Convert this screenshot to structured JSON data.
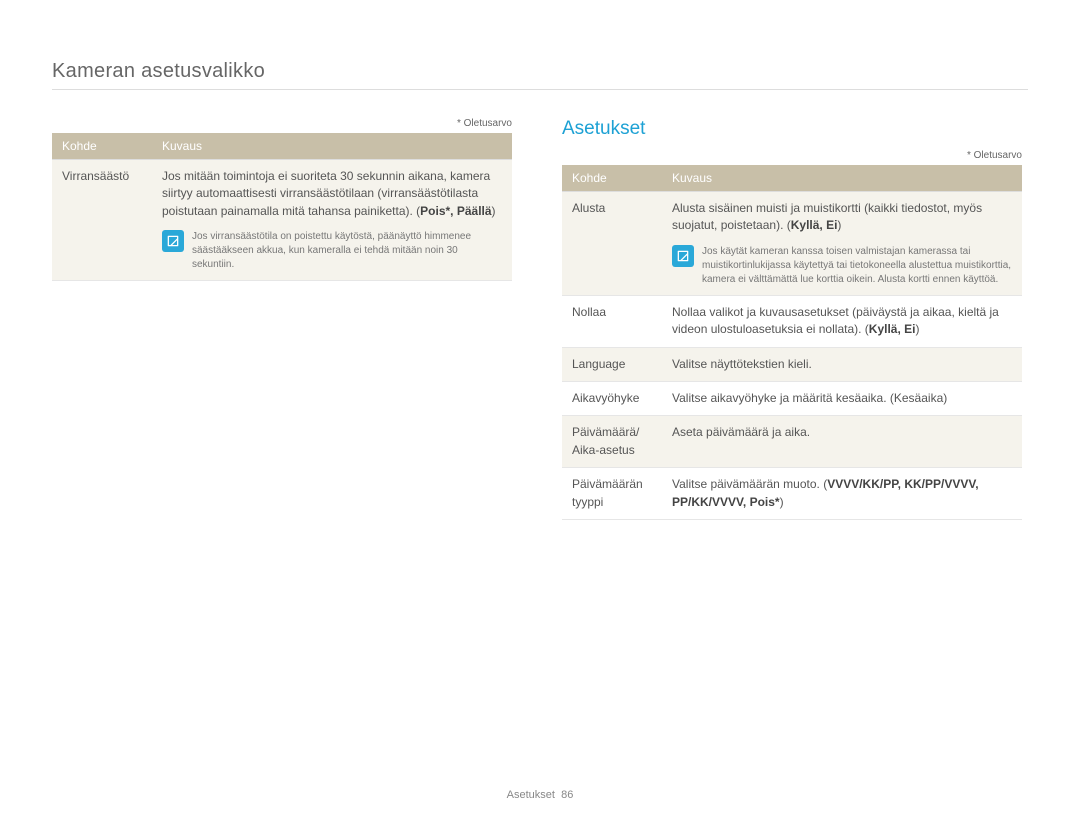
{
  "header": {
    "title": "Kameran asetusvalikko"
  },
  "default_label": "* Oletusarvo",
  "left": {
    "table": {
      "col1": "Kohde",
      "col2": "Kuvaus",
      "rows": [
        {
          "label": "Virransäästö",
          "desc_pre": "Jos mitään toimintoja ei suoriteta 30 sekunnin aikana, kamera siirtyy automaattisesti virransäästötilaan (virransäästötilasta poistutaan painamalla mitä tahansa painiketta). (",
          "desc_bold": "Pois*, Päällä",
          "desc_post": ")",
          "note": "Jos virransäästötila on poistettu käytöstä, päänäyttö himmenee säästääkseen akkua, kun kameralla ei tehdä mitään noin 30 sekuntiin."
        }
      ]
    }
  },
  "right": {
    "title": "Asetukset",
    "table": {
      "col1": "Kohde",
      "col2": "Kuvaus",
      "rows": [
        {
          "label": "Alusta",
          "desc_pre": "Alusta sisäinen muisti ja muistikortti (kaikki tiedostot, myös suojatut, poistetaan). (",
          "desc_bold": "Kyllä, Ei",
          "desc_post": ")",
          "note": "Jos käytät kameran kanssa toisen valmistajan kamerassa tai muistikortinlukijassa käytettyä tai tietokoneella alustettua muistikorttia, kamera ei välttämättä lue korttia oikein. Alusta kortti ennen käyttöä.",
          "bg": true
        },
        {
          "label": "Nollaa",
          "desc_pre": "Nollaa valikot ja kuvausasetukset (päiväystä ja aikaa, kieltä ja videon ulostuloasetuksia ei nollata). (",
          "desc_bold": "Kyllä, Ei",
          "desc_post": ")"
        },
        {
          "label": "Language",
          "desc_plain": "Valitse näyttötekstien kieli.",
          "bg": true
        },
        {
          "label": "Aikavyöhyke",
          "desc_plain": "Valitse aikavyöhyke ja määritä kesäaika. (Kesäaika)"
        },
        {
          "label": "Päivämäärä/\nAika-asetus",
          "desc_plain": "Aseta päivämäärä ja aika.",
          "bg": true
        },
        {
          "label": "Päivämäärän tyyppi",
          "desc_pre": "Valitse päivämäärän muoto. (",
          "desc_bold": "VVVV/KK/PP, KK/PP/VVVV, PP/KK/VVVV, Pois*",
          "desc_post": ")"
        }
      ]
    }
  },
  "footer": {
    "label": "Asetukset",
    "page": "86"
  }
}
